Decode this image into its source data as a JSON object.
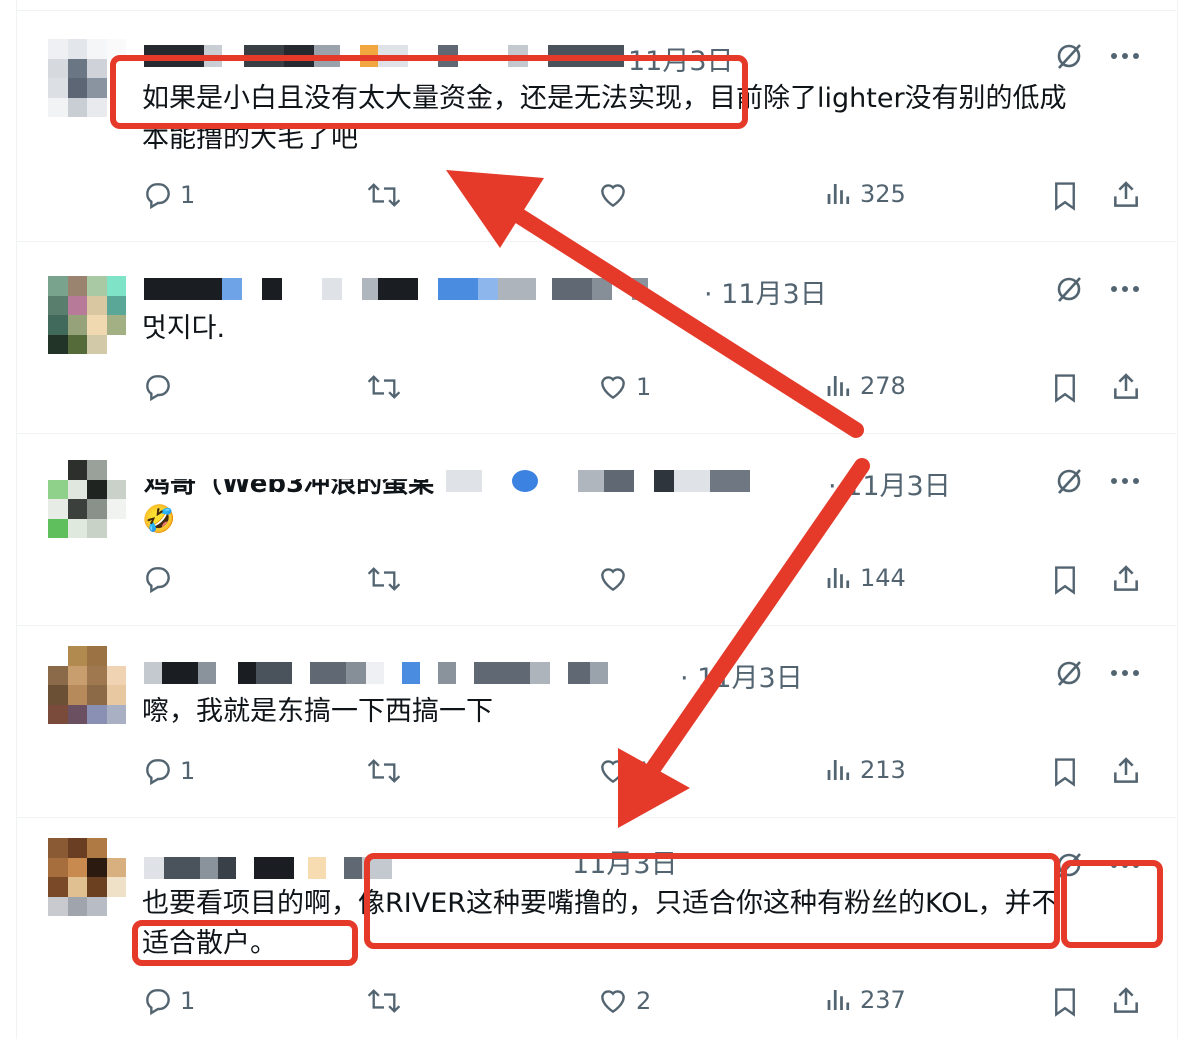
{
  "tweets": [
    {
      "date": "11月3日",
      "text_line1": "如果是小白且没有太大量资金，还是无法实现，目前除了lighter没有别的低成",
      "text_line2": "本能撸的大毛了吧",
      "replies": "1",
      "retweets": "",
      "likes": "",
      "views": "325"
    },
    {
      "date": "· 11月3日",
      "text_line1": "멋지다.",
      "text_line2": "",
      "replies": "",
      "retweets": "",
      "likes": "1",
      "views": "278"
    },
    {
      "header_name": "鸡哥（Web3冲浪的蛋某",
      "date": "· 11月3日",
      "text_line1": "🤣",
      "text_line2": "",
      "replies": "",
      "retweets": "",
      "likes": "",
      "views": "144"
    },
    {
      "date": "· 11月3日",
      "text_line1": "嚓，我就是东搞一下西搞一下",
      "text_line2": "",
      "replies": "1",
      "retweets": "",
      "likes": "1",
      "views": "213"
    },
    {
      "date": "11月3日",
      "text_line1": "也要看项目的啊，像RIVER这种要嘴撸的，只适合你这种有粉丝的KOL，并不",
      "text_line2": "适合散户。",
      "replies": "1",
      "retweets": "",
      "likes": "2",
      "views": "237"
    }
  ],
  "icons": {
    "reply": "reply-icon",
    "retweet": "retweet-icon",
    "like": "heart-icon",
    "views": "views-icon",
    "bookmark": "bookmark-icon",
    "share": "share-icon",
    "grok": "grok-icon",
    "more": "more-icon"
  },
  "colors": {
    "annotation": "#e53a2a",
    "secondary_text": "#536471",
    "divider": "#eff3f4"
  }
}
